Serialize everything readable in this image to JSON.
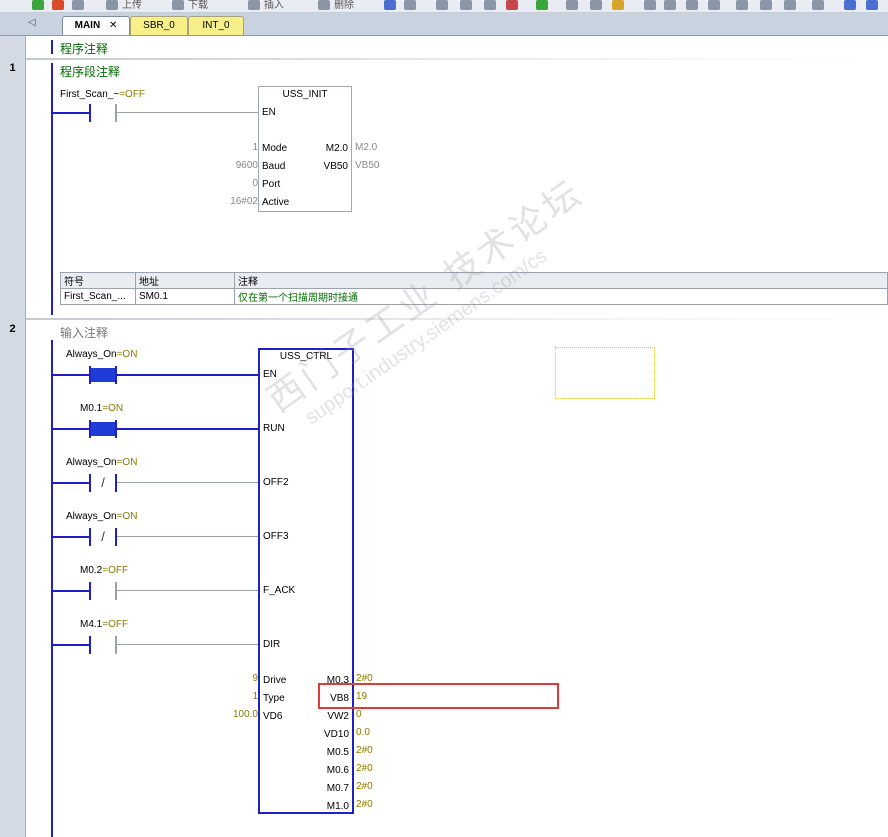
{
  "toolbar": {
    "upload_label": "上传",
    "download_label": "下载",
    "insert_label": "插入",
    "delete_label": "删除"
  },
  "tabs": [
    {
      "label": "MAIN"
    },
    {
      "label": "SBR_0"
    },
    {
      "label": "INT_0"
    }
  ],
  "program_comment": "程序注释",
  "network1": {
    "number": "1",
    "comment": "程序段注释",
    "contact_label": "First_Scan_~",
    "contact_state": "=OFF",
    "block": {
      "title": "USS_INIT",
      "en": "EN",
      "inputs": [
        {
          "value": "1",
          "pin": "Mode"
        },
        {
          "value": "9600",
          "pin": "Baud"
        },
        {
          "value": "0",
          "pin": "Port"
        },
        {
          "value": "16#02",
          "pin": "Active"
        }
      ],
      "outputs": [
        {
          "pin": "M2.0",
          "value": "M2.0"
        },
        {
          "pin": "VB50",
          "value": "VB50"
        }
      ]
    },
    "symbol_table": {
      "headers": [
        "符号",
        "地址",
        "注释"
      ],
      "rows": [
        [
          "First_Scan_...",
          "SM0.1",
          "仅在第一个扫描周期时接通"
        ]
      ]
    }
  },
  "network2": {
    "number": "2",
    "comment": "输入注释",
    "contacts": [
      {
        "name": "Always_On",
        "state": "=ON",
        "pin": "EN"
      },
      {
        "name": "M0.1",
        "state": "=ON",
        "pin": "RUN"
      },
      {
        "name": "Always_On",
        "state": "=ON",
        "pin": "OFF2"
      },
      {
        "name": "Always_On",
        "state": "=ON",
        "pin": "OFF3"
      },
      {
        "name": "M0.2",
        "state": "=OFF",
        "pin": "F_ACK"
      },
      {
        "name": "M4.1",
        "state": "=OFF",
        "pin": "DIR"
      }
    ],
    "block": {
      "title": "USS_CTRL",
      "inputs": [
        {
          "value": "9",
          "pin": "Drive"
        },
        {
          "value": "1",
          "pin": "Type"
        },
        {
          "value": "100.0",
          "pin": "VD6"
        }
      ],
      "outputs": [
        {
          "pin": "M0.3",
          "value": "2#0"
        },
        {
          "pin": "VB8",
          "value": "19"
        },
        {
          "pin": "VW2",
          "value": "0"
        },
        {
          "pin": "VD10",
          "value": "0.0"
        },
        {
          "pin": "M0.5",
          "value": "2#0"
        },
        {
          "pin": "M0.6",
          "value": "2#0"
        },
        {
          "pin": "M0.7",
          "value": "2#0"
        },
        {
          "pin": "M1.0",
          "value": "2#0"
        }
      ]
    }
  },
  "watermark": {
    "line1": "西门子工业 技术论坛",
    "line2": "support.industry.siemens.com/cs"
  },
  "colors": {
    "power_rail": "#2020c8",
    "contact_on": "#1f3cd9",
    "highlight_box": "#e03a3a",
    "status_value": "#8b7a00",
    "comment_green": "#006b00"
  }
}
